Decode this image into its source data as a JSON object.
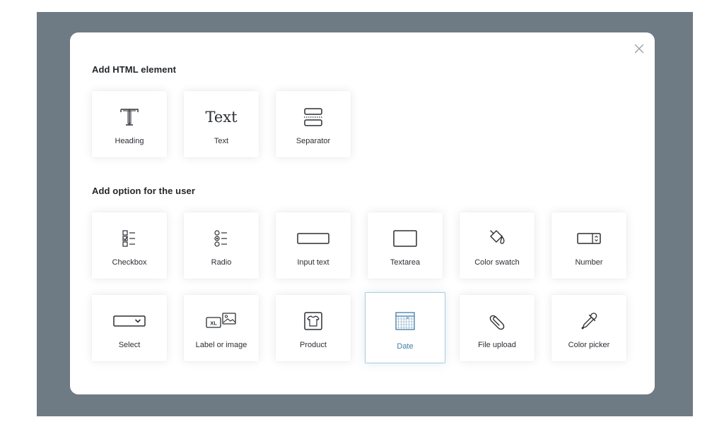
{
  "modal": {
    "close_label": "×",
    "sections": {
      "html": {
        "title": "Add HTML element",
        "items": [
          {
            "label": "Heading",
            "icon": "heading-icon"
          },
          {
            "label": "Text",
            "icon": "text-icon",
            "glyph": "Text"
          },
          {
            "label": "Separator",
            "icon": "separator-icon"
          }
        ]
      },
      "user": {
        "title": "Add option for the user",
        "items": [
          {
            "label": "Checkbox",
            "icon": "checkbox-icon"
          },
          {
            "label": "Radio",
            "icon": "radio-icon"
          },
          {
            "label": "Input text",
            "icon": "input-text-icon"
          },
          {
            "label": "Textarea",
            "icon": "textarea-icon"
          },
          {
            "label": "Color swatch",
            "icon": "color-swatch-icon"
          },
          {
            "label": "Number",
            "icon": "number-icon"
          },
          {
            "label": "Select",
            "icon": "select-icon"
          },
          {
            "label": "Label or image",
            "icon": "label-or-image-icon",
            "badge": "XL"
          },
          {
            "label": "Product",
            "icon": "product-icon"
          },
          {
            "label": "Date",
            "icon": "date-icon",
            "selected": true
          },
          {
            "label": "File upload",
            "icon": "file-upload-icon"
          },
          {
            "label": "Color picker",
            "icon": "color-picker-icon"
          }
        ]
      }
    }
  },
  "colors": {
    "backdrop": "#6e7a84",
    "modal": "#ffffff",
    "selected_border": "#a9cbdc",
    "selected_text": "#3f7ca6"
  }
}
